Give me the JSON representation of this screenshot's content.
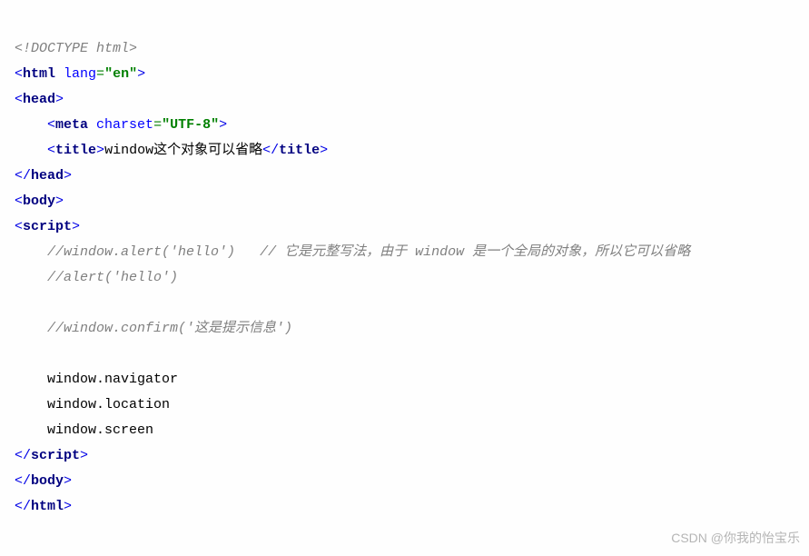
{
  "code": {
    "doctype": "<!DOCTYPE html>",
    "html_open_1": "<",
    "html_open_tag": "html",
    "html_open_attr": " lang",
    "html_open_eq": "=",
    "html_open_val": "\"en\"",
    "html_open_2": ">",
    "head_open_1": "<",
    "head_open_tag": "head",
    "head_open_2": ">",
    "meta_indent": "    ",
    "meta_open_1": "<",
    "meta_tag": "meta",
    "meta_attr": " charset",
    "meta_eq": "=",
    "meta_val": "\"UTF-8\"",
    "meta_close": ">",
    "title_indent": "    ",
    "title_open_1": "<",
    "title_tag": "title",
    "title_open_2": ">",
    "title_text": "window这个对象可以省略",
    "title_close_1": "</",
    "title_close_2": ">",
    "head_close_1": "</",
    "head_close_tag": "head",
    "head_close_2": ">",
    "body_open_1": "<",
    "body_open_tag": "body",
    "body_open_2": ">",
    "script_open_1": "<",
    "script_tag": "script",
    "script_open_2": ">",
    "line1_indent": "    ",
    "line1_comment1": "//window.alert('hello')",
    "line1_spacer": "   ",
    "line1_comment2": "// 它是元整写法，由于 window 是一个全局的对象，所以它可以省略",
    "line2_indent": "    ",
    "line2_comment": "//alert('hello')",
    "line3_indent": "    ",
    "line3_comment": "//window.confirm('这是提示信息')",
    "line4_indent": "    ",
    "line4_code": "window.navigator",
    "line5_indent": "    ",
    "line5_code": "window.location",
    "line6_indent": "    ",
    "line6_code": "window.screen",
    "script_close_1": "</",
    "script_close_2": ">",
    "body_close_1": "</",
    "body_close_tag": "body",
    "body_close_2": ">",
    "html_close_1": "</",
    "html_close_tag": "html",
    "html_close_2": ">"
  },
  "watermark": "CSDN @你我的怡宝乐"
}
